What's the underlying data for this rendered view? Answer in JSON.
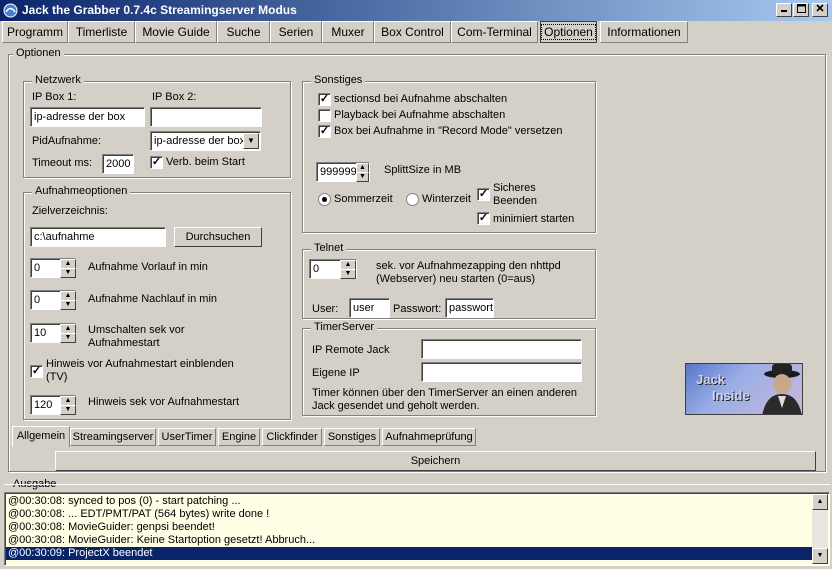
{
  "window": {
    "title": "Jack the Grabber 0.7.4c Streamingserver Modus"
  },
  "menu_tabs": [
    "Programm",
    "Timerliste",
    "Movie Guide",
    "Suche",
    "Serien",
    "Muxer",
    "Box Control",
    "Com-Terminal",
    "Optionen",
    "Informationen"
  ],
  "active_menu_tab": "Optionen",
  "optionen_group": "Optionen",
  "netzwerk": {
    "title": "Netzwerk",
    "ip_box1_label": "IP Box 1:",
    "ip_box1_value": "ip-adresse der box",
    "ip_box2_label": "IP Box 2:",
    "ip_box2_value": "",
    "pid_label": "PidAufnahme:",
    "pid_value": "ip-adresse der box",
    "timeout_label": "Timeout ms:",
    "timeout_value": "2000",
    "verb_label": "Verb. beim Start",
    "verb_checked": true
  },
  "aufnahme": {
    "title": "Aufnahmeoptionen",
    "ziel_label": "Zielverzeichnis:",
    "ziel_value": "c:\\aufnahme",
    "browse_label": "Durchsuchen",
    "vorlauf_value": "0",
    "vorlauf_label": "Aufnahme Vorlauf in min",
    "nachlauf_value": "0",
    "nachlauf_label": "Aufnahme Nachlauf in min",
    "umschalten_value": "10",
    "umschalten_label_1": "Umschalten sek vor",
    "umschalten_label_2": "Aufnahmestart",
    "hinweis_checked": true,
    "hinweis_label_1": "Hinweis vor Aufnahmestart einblenden",
    "hinweis_label_2": "(TV)",
    "hinweis_sek_value": "120",
    "hinweis_sek_label": "Hinweis sek vor Aufnahmestart"
  },
  "sonstiges": {
    "title": "Sonstiges",
    "options": [
      {
        "label": "sectionsd bei Aufnahme abschalten",
        "checked": true
      },
      {
        "label": "Playback bei Aufnahme abschalten",
        "checked": false
      },
      {
        "label": "Box bei Aufnahme in \"Record Mode\" versetzen",
        "checked": true
      }
    ],
    "split_value": "999999",
    "split_label": "SplittSize in MB",
    "sommerzeit_label": "Sommerzeit",
    "winterzeit_label": "Winterzeit",
    "selected_time": "Sommerzeit",
    "sicheres_label_1": "Sicheres",
    "sicheres_label_2": "Beenden",
    "sicheres_checked": true,
    "minimiert_label": "minimiert starten",
    "minimiert_checked": true
  },
  "telnet": {
    "title": "Telnet",
    "value": "0",
    "desc_1": "sek. vor Aufnahmezapping den nhttpd",
    "desc_2": "(Webserver) neu starten (0=aus)",
    "user_label": "User:",
    "user_value": "user",
    "pass_label": "Passwort:",
    "pass_value": "passwort"
  },
  "timerserver": {
    "title": "TimerServer",
    "remote_label": "IP Remote Jack",
    "remote_value": "",
    "eigene_label": "Eigene IP",
    "eigene_value": "",
    "desc_1": "Timer können über den TimerServer an einen anderen",
    "desc_2": "Jack gesendet und geholt werden."
  },
  "logo": {
    "line1": "Jack",
    "line2": "Inside"
  },
  "bottom_tabs": [
    "Allgemein",
    "Streamingserver",
    "UserTimer",
    "Engine",
    "Clickfinder",
    "Sonstiges",
    "Aufnahmeprüfung"
  ],
  "active_bottom_tab": "Allgemein",
  "save_label": "Speichern",
  "ausgabe": {
    "title": "Ausgabe",
    "lines": [
      "@00:30:08: synced to pos (0) - start patching ...",
      "@00:30:08: ... EDT/PMT/PAT (564 bytes) write done !",
      "@00:30:08: MovieGuider: genpsi beendet!",
      "@00:30:08: MovieGuider: Keine Startoption gesetzt! Abbruch...",
      "@00:30:09: ProjectX beendet"
    ],
    "selected_index": 4
  },
  "colors": {
    "title_start": "#0a246a",
    "title_end": "#a6caf0",
    "log_bg": "#ffffe6",
    "selection": "#0a246a"
  }
}
